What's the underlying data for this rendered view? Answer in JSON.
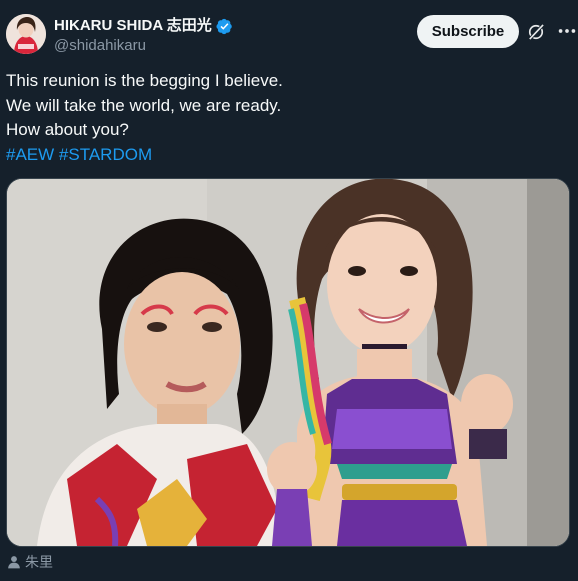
{
  "post": {
    "author": {
      "display_name": "HIKARU SHIDA 志田光",
      "handle": "@shidahikaru",
      "verified": true,
      "avatar_icon": "profile-photo"
    },
    "subscribe_label": "Subscribe",
    "grok_icon": "grok-icon",
    "more_icon": "more-icon",
    "text_lines": [
      "This reunion is the begging I believe.",
      "We will take the world, we are ready.",
      "How about you?"
    ],
    "hashtags": [
      "#AEW",
      "#STARDOM"
    ],
    "media": {
      "description_icon": "photo"
    },
    "photo_credit": "朱里",
    "colors": {
      "background": "#15202b",
      "text": "#f7f9f9",
      "secondary_text": "#8b98a5",
      "link": "#1d9bf0",
      "verified": "#1d9bf0",
      "button_bg": "#eff3f4"
    }
  }
}
